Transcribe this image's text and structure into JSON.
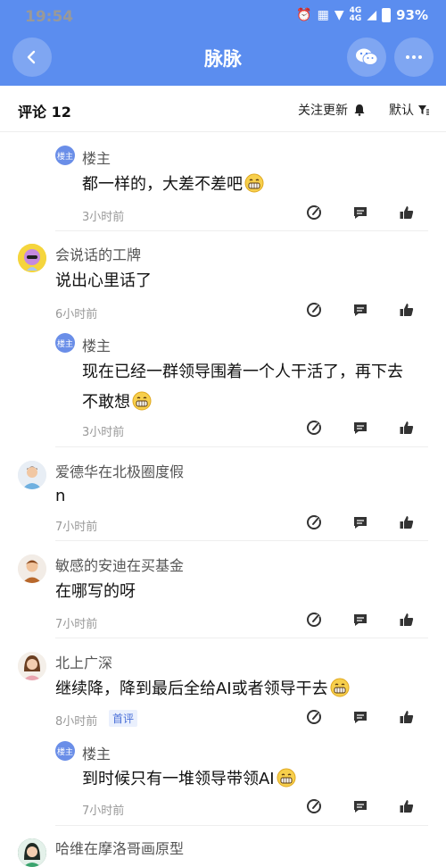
{
  "status_bar": {
    "time": "19:54",
    "battery": "93%",
    "net1": "4G",
    "net2": "4G"
  },
  "nav": {
    "title": "脉脉",
    "back_icon": "back-chevron-icon",
    "wechat_icon": "wechat-icon",
    "more_icon": "more-dots-icon"
  },
  "comments_header": {
    "title": "评论 12",
    "follow_label": "关注更新",
    "sort_label": "默认"
  },
  "comments": [
    {
      "name": "楼主",
      "text": "都一样的，大差不差吧",
      "time": "3小时前",
      "is_owner": true
    },
    {
      "name": "会说话的工牌",
      "text": "说出心里话了",
      "time": "6小时前"
    },
    {
      "name": "楼主",
      "text_line1": "现在已经一群领导围着一个人干活了，再下去",
      "text_line2": "不敢想",
      "time": "3小时前",
      "is_owner": true
    },
    {
      "name": "爱德华在北极圈度假",
      "text": "n",
      "time": "7小时前"
    },
    {
      "name": "敏感的安迪在买基金",
      "text": "在哪写的呀",
      "time": "7小时前"
    },
    {
      "name": "北上广深",
      "text": "继续降，降到最后全给AI或者领导干去",
      "time": "8小时前",
      "badge": "首评"
    },
    {
      "name": "楼主",
      "text": "到时候只有一堆领导带领AI",
      "time": "7小时前",
      "is_owner": true
    },
    {
      "name": "哈维在摩洛哥画原型"
    }
  ],
  "owner_badge_label": "楼主"
}
